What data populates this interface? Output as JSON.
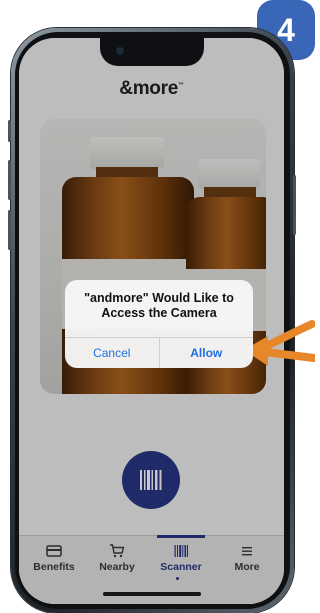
{
  "app": {
    "logo_text": "&more",
    "logo_tm": "™"
  },
  "step_badge": "4",
  "alert": {
    "title": "\"andmore\" Would Like to Access the Camera",
    "cancel_label": "Cancel",
    "allow_label": "Allow"
  },
  "scan_button": {
    "icon": "barcode-icon"
  },
  "tabs": [
    {
      "label": "Benefits",
      "icon": "card-icon",
      "active": false
    },
    {
      "label": "Nearby",
      "icon": "cart-icon",
      "active": false
    },
    {
      "label": "Scanner",
      "icon": "barcode-icon",
      "active": true
    },
    {
      "label": "More",
      "icon": "menu-icon",
      "active": false
    }
  ],
  "colors": {
    "brand": "#2a3686",
    "badge": "#3a66b8",
    "pointer": "#e8862a",
    "alert_action": "#1f6fe0"
  }
}
